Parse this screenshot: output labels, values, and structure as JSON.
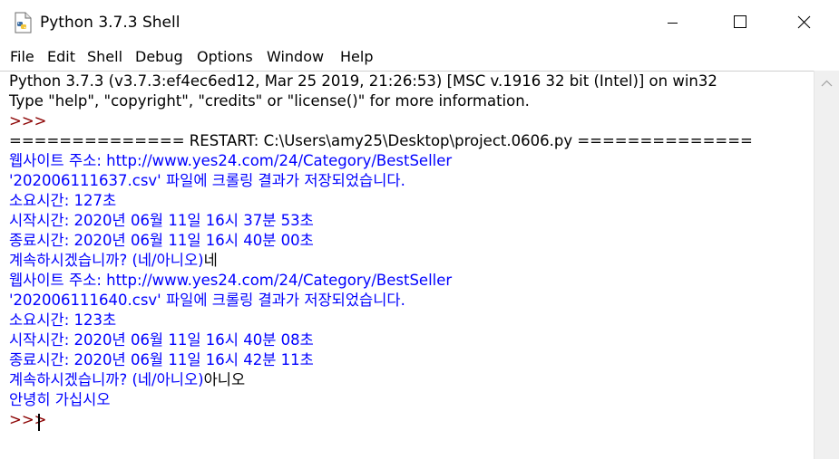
{
  "window": {
    "title": "Python 3.7.3 Shell"
  },
  "icons": {
    "app": "python-file-icon",
    "minimize": "minimize-icon",
    "maximize": "maximize-icon",
    "close": "close-icon",
    "scroll_up": "chevron-up-icon"
  },
  "colors": {
    "output": "#000000",
    "stdout_blue": "#0000ff",
    "prompt": "#8b0000"
  },
  "menu": [
    {
      "label": "File"
    },
    {
      "label": "Edit"
    },
    {
      "label": "Shell"
    },
    {
      "label": "Debug"
    },
    {
      "label": "Options"
    },
    {
      "label": "Window"
    },
    {
      "label": "Help"
    }
  ],
  "shell": {
    "lines": [
      {
        "text": "Python 3.7.3 (v3.7.3:ef4ec6ed12, Mar 25 2019, 21:26:53) [MSC v.1916 32 bit (Intel)] on win32"
      },
      {
        "text": "Type \"help\", \"copyright\", \"credits\" or \"license()\" for more information."
      },
      {
        "text": ">>> "
      },
      {
        "text": "============== RESTART: C:\\Users\\amy25\\Desktop\\project.0606.py =============="
      },
      {
        "text": "웹사이트 주소: http://www.yes24.com/24/Category/BestSeller"
      },
      {
        "text": "'202006111637.csv' 파일에 크롤링 결과가 저장되었습니다."
      },
      {
        "text": "소요시간: 127초"
      },
      {
        "text": "시작시간: 2020년 06월 11일 16시 37분 53초"
      },
      {
        "text": "종료시간: 2020년 06월 11일 16시 40분 00초"
      },
      {
        "prompt": "계속하시겠습니까? (네/아니오)",
        "input": "네"
      },
      {
        "text": "웹사이트 주소: http://www.yes24.com/24/Category/BestSeller"
      },
      {
        "text": "'202006111640.csv' 파일에 크롤링 결과가 저장되었습니다."
      },
      {
        "text": "소요시간: 123초"
      },
      {
        "text": "시작시간: 2020년 06월 11일 16시 40분 08초"
      },
      {
        "text": "종료시간: 2020년 06월 11일 16시 42분 11초"
      },
      {
        "prompt": "계속하시겠습니까? (네/아니오)",
        "input": "아니오"
      },
      {
        "text": "안녕히 가십시오"
      },
      {
        "text": ">>> "
      }
    ]
  }
}
